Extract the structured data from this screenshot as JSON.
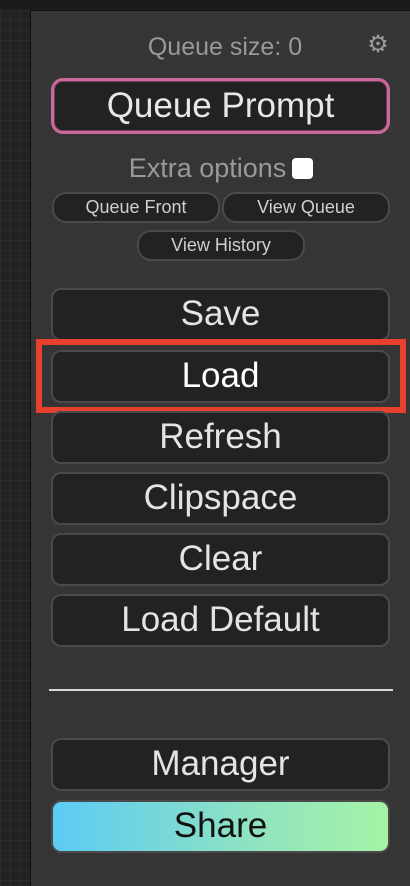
{
  "queue": {
    "size_label": "Queue size: 0"
  },
  "icons": {
    "settings": "gear-icon"
  },
  "buttons": {
    "queue_prompt": "Queue Prompt",
    "queue_front": "Queue Front",
    "view_queue": "View Queue",
    "view_history": "View History",
    "save": "Save",
    "load": "Load",
    "refresh": "Refresh",
    "clipspace": "Clipspace",
    "clear": "Clear",
    "load_default": "Load Default",
    "manager": "Manager",
    "share": "Share"
  },
  "extra_options": {
    "label": "Extra options",
    "checked": false
  },
  "colors": {
    "highlight": "#e8402e",
    "queue_prompt_border": "#c86a9a",
    "share_gradient_start": "#5ccbf5",
    "share_gradient_end": "#a6f3a6"
  }
}
